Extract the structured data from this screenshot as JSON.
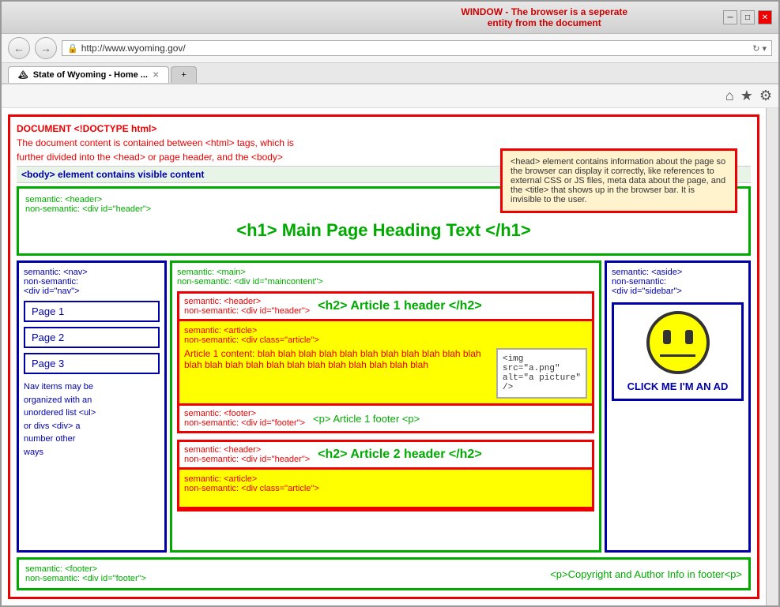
{
  "window": {
    "title_bar_left": "WINDOW - The browser  is a seperate",
    "title_bar_right": "entity from the document",
    "min_btn": "─",
    "max_btn": "□",
    "close_btn": "✕"
  },
  "address_bar": {
    "url": "http://www.wyoming.gov/",
    "refresh": "↻",
    "dropdown": "▾"
  },
  "tabs": [
    {
      "label": "State of Wyoming - Home ...",
      "active": true
    },
    {
      "label": "+",
      "active": false
    }
  ],
  "toolbar_icons": [
    "⌂",
    "★",
    "⚙"
  ],
  "document": {
    "doctype_label": "DOCUMENT  <!DOCTYPE html>",
    "doc_desc_line1": "The document content is contained between <html> tags, which is",
    "doc_desc_line2": "further divided into the <head> or page header, and the <body>",
    "body_label": "<body> element contains visible content",
    "head_callout": {
      "text": "<head> element contains information about the page so the browser can display it correctly, like references to external CSS or JS files, meta data about the page, and the <title> that shows up in the browser bar. It is invisible to the user."
    }
  },
  "header_section": {
    "semantic_label": "semantic: <header>",
    "non_semantic_label": "non-semantic: <div id=\"header\">",
    "h1_text": "<h1> Main Page Heading Text </h1>"
  },
  "nav": {
    "semantic_label": "semantic: <nav>",
    "non_semantic_label": "non-semantic:",
    "non_semantic_label2": "<div id=\"nav\">",
    "page1": "Page 1",
    "page2": "Page 2",
    "page3": "Page 3",
    "desc_line1": "Nav items may be",
    "desc_line2": "organized with an",
    "desc_line3": "unordered list <ul>",
    "desc_line4": "or divs <div> a",
    "desc_line5": "number other",
    "desc_line6": "ways"
  },
  "main": {
    "semantic_label": "semantic: <main>",
    "non_semantic_label": "non-semantic: <div id=\"maincontent\">",
    "articles": [
      {
        "header_sem": "semantic: <header>",
        "header_nonsem": "non-semantic: <div id=\"header\">",
        "header_title": "<h2> Article 1 header </h2>",
        "content_sem": "semantic: <article>",
        "content_nonsem": "non-semantic: <div class=\"article\">",
        "content_text": "Article 1 content: blah blah blah blah blah blah blah blah blah blah blah blah blah blah blah blah blah blah blah blah blah blah blah",
        "img_code": "<img\nsrc=\"a.png\"\nalt=\"a picture\"\n/>",
        "footer_sem": "semantic: <footer>",
        "footer_nonsem": "non-semantic: <div id=\"footer\">",
        "footer_text": "<p> Article 1 footer <p>"
      },
      {
        "header_sem": "semantic: <header>",
        "header_nonsem": "non-semantic: <div id=\"header\">",
        "header_title": "<h2> Article 2 header </h2>",
        "content_sem": "semantic: <article>",
        "content_nonsem": "non-semantic: <div class=\"article\">"
      }
    ]
  },
  "aside": {
    "semantic_label": "semantic: <aside>",
    "non_semantic_label": "non-semantic:",
    "non_semantic_label2": "<div id=\"sidebar\">",
    "ad_text": "CLICK ME I'M AN AD"
  },
  "page_footer": {
    "semantic_label": "semantic: <footer>",
    "non_semantic_label": "non-semantic: <div id=\"footer\">",
    "footer_text": "<p>Copyright and Author Info in footer<p>"
  }
}
